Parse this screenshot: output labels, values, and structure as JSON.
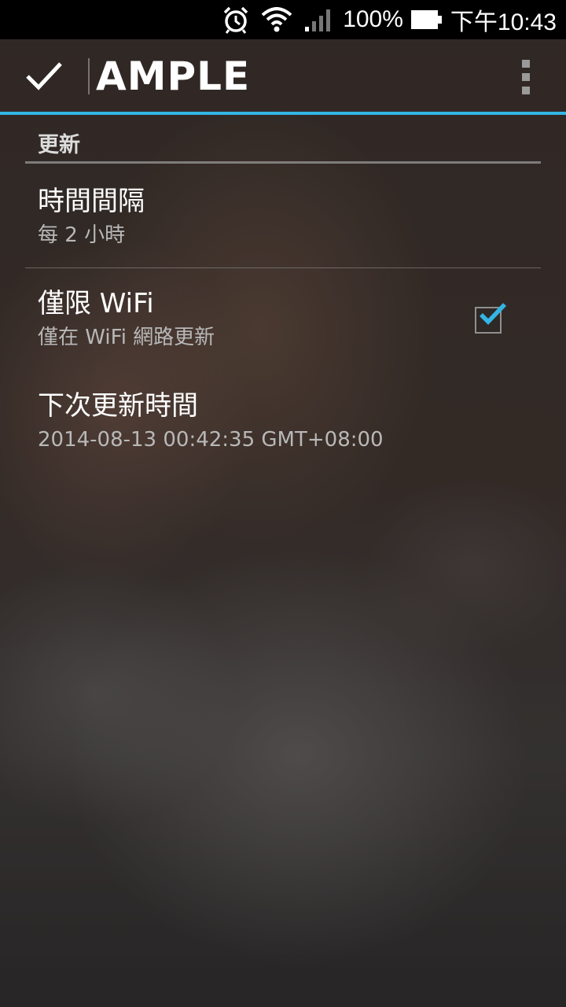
{
  "status_bar": {
    "battery_text": "100%",
    "clock": "下午10:43",
    "icons": [
      "alarm-icon",
      "wifi-icon",
      "signal-icon",
      "battery-icon"
    ]
  },
  "action_bar": {
    "title": "AMPLE",
    "done_icon": "checkmark-icon",
    "overflow_icon": "overflow-menu-icon"
  },
  "category": {
    "label": "更新"
  },
  "preferences": [
    {
      "title": "時間間隔",
      "summary": "每 2 小時"
    },
    {
      "title": "僅限 WiFi",
      "summary": "僅在 WiFi 網路更新",
      "checked": true
    },
    {
      "title": "下次更新時間",
      "summary": "2014-08-13 00:42:35 GMT+08:00"
    }
  ],
  "colors": {
    "accent": "#33b5e5",
    "status_bar_bg": "#000000"
  }
}
